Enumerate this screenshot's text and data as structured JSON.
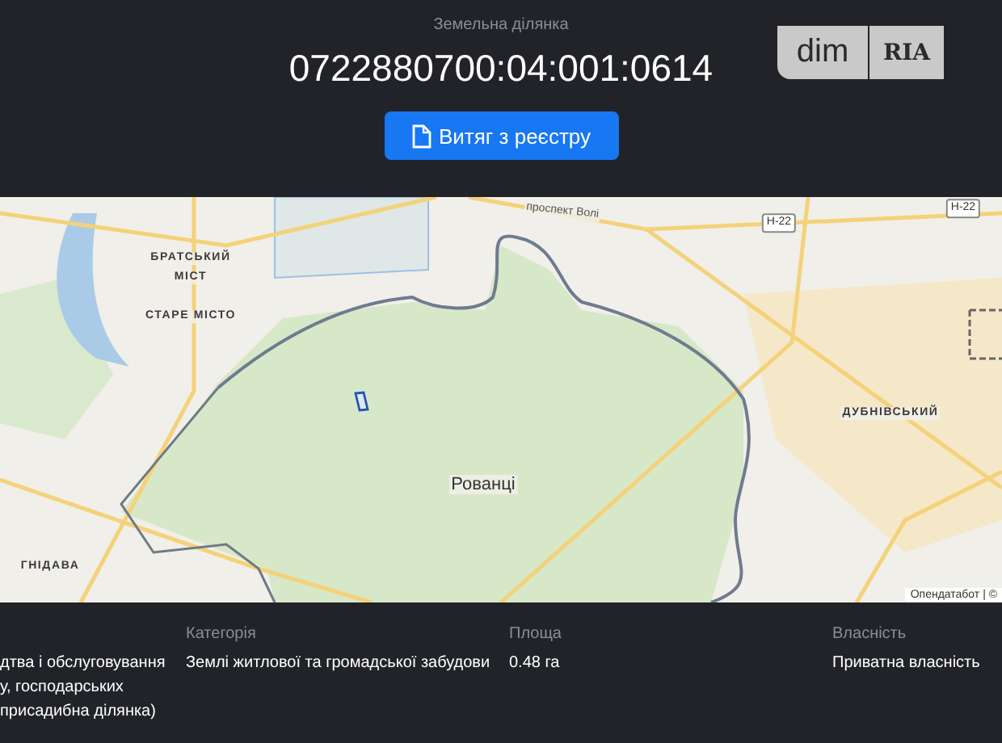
{
  "header": {
    "subtitle": "Земельна ділянка",
    "cadastral_number": "0722880700:04:001:0614",
    "button": "Витяг з реєстру",
    "logo": {
      "left": "dim",
      "right": "RIA"
    }
  },
  "map": {
    "labels": [
      {
        "kind": "district",
        "text": "БРАТСЬКИЙ"
      },
      {
        "kind": "district",
        "text": "МІСТ"
      },
      {
        "kind": "district",
        "text": "СТАРЕ МІСТО"
      },
      {
        "kind": "district",
        "text": "ДУБНІВСЬКИЙ"
      },
      {
        "kind": "district",
        "text": "ГНІДАВА"
      },
      {
        "kind": "place",
        "text": "Рованці"
      },
      {
        "kind": "road",
        "text": "проспект Волі"
      },
      {
        "kind": "shield",
        "text": "Н-22"
      },
      {
        "kind": "shield",
        "text": "Н-22"
      }
    ],
    "attribution": "Опендатабот | ©"
  },
  "details": [
    {
      "value_lines": [
        "дтва і обслуговування",
        "у, господарських",
        "присадибна ділянка)"
      ]
    },
    {
      "label": "Категорія",
      "value_lines": [
        "Землі житлової та громадської забудови"
      ]
    },
    {
      "label": "Площа",
      "value_lines": [
        "0.48 га"
      ]
    },
    {
      "label": "Власність",
      "value_lines": [
        "Приватна власність"
      ]
    }
  ]
}
